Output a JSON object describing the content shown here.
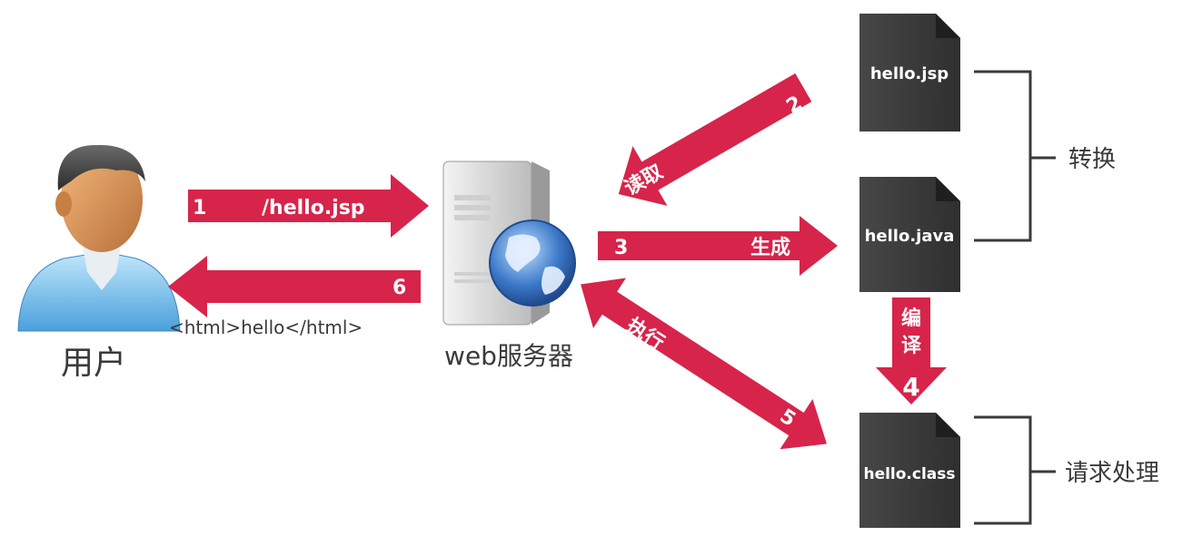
{
  "user": {
    "label": "用户"
  },
  "server": {
    "label": "web服务器"
  },
  "files": {
    "jsp": "hello.jsp",
    "java": "hello.java",
    "class": "hello.class"
  },
  "arrows": {
    "a1": {
      "num": "1",
      "text": "/hello.jsp"
    },
    "a2": {
      "num": "2",
      "text": "读取"
    },
    "a3": {
      "num": "3",
      "text": "生成"
    },
    "a4": {
      "num": "4",
      "text_line1": "编",
      "text_line2": "译"
    },
    "a5": {
      "num": "5",
      "text": "执行"
    },
    "a6": {
      "num": "6",
      "text": "<html>hello</html>"
    }
  },
  "brackets": {
    "convert": "转换",
    "request": "请求处理"
  },
  "colors": {
    "arrow": "#d7244a",
    "doc": "#3f3f3f",
    "bracket": "#3a3a3a"
  }
}
